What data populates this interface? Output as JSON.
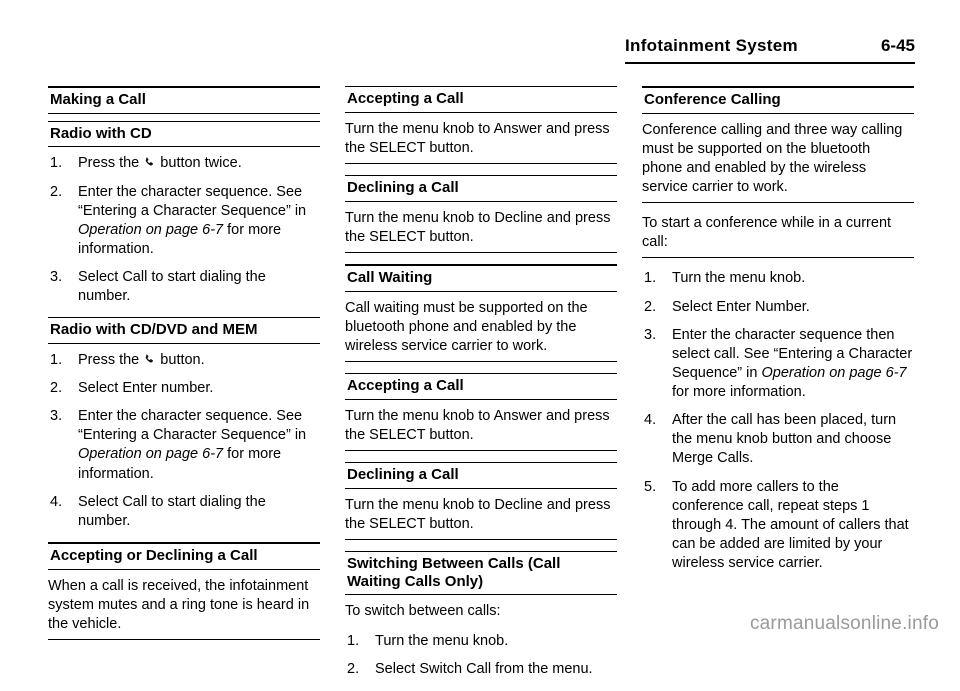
{
  "header": {
    "title": "Infotainment System",
    "page_number": "6-45"
  },
  "footer": {
    "watermark": "carmanualsonline.info"
  },
  "icons": {
    "phone": "phone-handset-icon"
  },
  "columns": [
    {
      "name": "column-left",
      "blocks": [
        {
          "type": "heading-main",
          "text": "Making a Call"
        },
        {
          "type": "heading-sub",
          "text": "Radio with CD"
        },
        {
          "type": "steps",
          "items": [
            {
              "num": "1.",
              "pre": "Press the ",
              "icon": "phone",
              "post": " button twice."
            },
            {
              "num": "2.",
              "pre": "Enter the character sequence. See “Entering a Character Sequence” in ",
              "italic": "Operation on page 6-7",
              "post": " for more information."
            },
            {
              "num": "3.",
              "pre": "Select Call to start dialing the number."
            }
          ]
        },
        {
          "type": "heading-sub",
          "text": "Radio with CD/DVD and MEM"
        },
        {
          "type": "steps",
          "items": [
            {
              "num": "1.",
              "pre": "Press the ",
              "icon": "phone",
              "post": " button."
            },
            {
              "num": "2.",
              "pre": "Select Enter number."
            },
            {
              "num": "3.",
              "pre": "Enter the character sequence. See “Entering a Character Sequence” in ",
              "italic": "Operation on page 6-7",
              "post": " for more information."
            },
            {
              "num": "4.",
              "pre": "Select Call to start dialing the number."
            }
          ]
        },
        {
          "type": "heading-main",
          "text": "Accepting or Declining a Call"
        },
        {
          "type": "para-boxed",
          "text": "When a call is received, the infotainment system mutes and a ring tone is heard in the vehicle."
        }
      ]
    },
    {
      "name": "column-middle",
      "blocks": [
        {
          "type": "heading-sub",
          "text": "Accepting a Call"
        },
        {
          "type": "para-boxed",
          "text": "Turn the menu knob to Answer and press the SELECT button."
        },
        {
          "type": "heading-sub",
          "text": "Declining a Call"
        },
        {
          "type": "para-boxed",
          "text": "Turn the menu knob to Decline and press the SELECT button."
        },
        {
          "type": "heading-main",
          "text": "Call Waiting"
        },
        {
          "type": "para-boxed",
          "text": "Call waiting must be supported on the bluetooth phone and enabled by the wireless service carrier to work."
        },
        {
          "type": "heading-sub",
          "text": "Accepting a Call"
        },
        {
          "type": "para-boxed",
          "text": "Turn the menu knob to Answer and press the SELECT button."
        },
        {
          "type": "heading-sub",
          "text": "Declining a Call"
        },
        {
          "type": "para-boxed",
          "text": "Turn the menu knob to Decline and press the SELECT button."
        },
        {
          "type": "heading-sub",
          "text": "Switching Between Calls (Call Waiting Calls Only)"
        },
        {
          "type": "para",
          "text": "To switch between calls:"
        },
        {
          "type": "steps",
          "items": [
            {
              "num": "1.",
              "pre": "Turn the menu knob."
            },
            {
              "num": "2.",
              "pre": "Select Switch Call from the menu."
            }
          ]
        }
      ]
    },
    {
      "name": "column-right",
      "blocks": [
        {
          "type": "heading-main",
          "text": "Conference Calling"
        },
        {
          "type": "para-boxed",
          "text": "Conference calling and three way calling must be supported on the bluetooth phone and enabled by the wireless service carrier to work."
        },
        {
          "type": "para-boxed",
          "text": "To start a conference while in a current call:"
        },
        {
          "type": "steps",
          "items": [
            {
              "num": "1.",
              "pre": "Turn the menu knob."
            },
            {
              "num": "2.",
              "pre": "Select Enter Number."
            },
            {
              "num": "3.",
              "pre": "Enter the character sequence then select call. See “Entering a Character Sequence” in ",
              "italic": "Operation on page 6-7",
              "post": " for more information."
            },
            {
              "num": "4.",
              "pre": "After the call has been placed, turn the menu knob button and choose Merge Calls."
            },
            {
              "num": "5.",
              "pre": "To add more callers to the conference call, repeat steps 1 through 4. The amount of callers that can be added are limited by your wireless service carrier."
            }
          ]
        }
      ]
    }
  ]
}
